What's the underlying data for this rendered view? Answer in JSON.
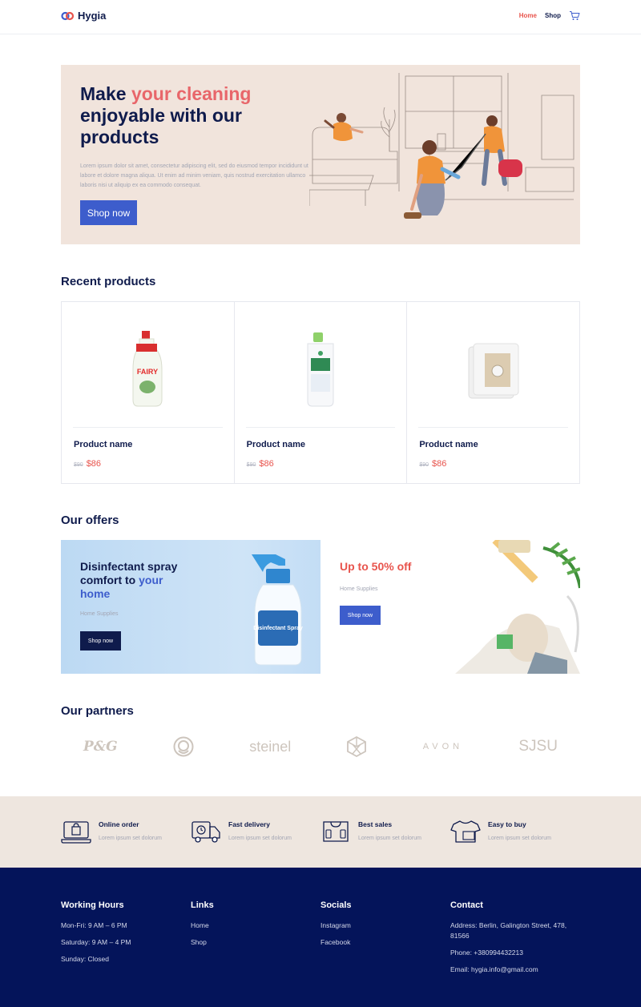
{
  "header": {
    "logo_text": "Hygia",
    "nav": [
      {
        "label": "Home",
        "active": true
      },
      {
        "label": "Shop",
        "active": false
      }
    ],
    "cart_icon": "cart-icon"
  },
  "hero": {
    "title_part1": "Make ",
    "title_accent": "your cleaning",
    "title_part2": " enjoyable with our products",
    "description": "Lorem ipsum dolor sit amet, consectetur adipiscing elit, sed do eiusmod tempor incididunt ut labore et dolore magna aliqua. Ut enim ad minim veniam, quis nostrud exercitation ullamco laboris nisi ut aliquip ex ea commodo consequat.",
    "button_label": "Shop now"
  },
  "recent": {
    "title": "Recent products",
    "products": [
      {
        "name": "Product name",
        "old_price": "$90",
        "price": "$86",
        "image": "dish-soap-bottle"
      },
      {
        "name": "Product name",
        "old_price": "$90",
        "price": "$86",
        "image": "detergent-bottle"
      },
      {
        "name": "Product name",
        "old_price": "$90",
        "price": "$86",
        "image": "vacuum-bags"
      }
    ]
  },
  "offers": {
    "title": "Our offers",
    "left": {
      "title_part1": "Disinfectant spray comfort to ",
      "title_blue": "your home",
      "category": "Home Supplies",
      "button_label": "Shop now",
      "label_on_bottle": "Disinfectant Spray"
    },
    "right": {
      "title": "Up to 50% off",
      "category": "Home Supplies",
      "button_label": "Shop now"
    }
  },
  "partners": {
    "title": "Our partners",
    "items": [
      "P&G",
      "",
      "steinel",
      "",
      "AVON",
      "SJSU"
    ]
  },
  "features": [
    {
      "title": "Online order",
      "sub": "Lorem ipsum set dolorum",
      "icon": "laptop-bag-icon"
    },
    {
      "title": "Fast delivery",
      "sub": "Lorem ipsum set dolorum",
      "icon": "delivery-truck-icon"
    },
    {
      "title": "Best sales",
      "sub": "Lorem ipsum set dolorum",
      "icon": "sale-tag-icon"
    },
    {
      "title": "Easy to buy",
      "sub": "Lorem ipsum set dolorum",
      "icon": "tshirt-icon"
    }
  ],
  "footer": {
    "hours": {
      "title": "Working Hours",
      "items": [
        "Mon-Fri: 9 AM – 6 PM",
        "Saturday: 9 AM – 4 PM",
        "Sunday: Closed"
      ]
    },
    "links": {
      "title": "Links",
      "items": [
        "Home",
        "Shop"
      ]
    },
    "socials": {
      "title": "Socials",
      "items": [
        "Instagram",
        "Facebook"
      ]
    },
    "contact": {
      "title": "Contact",
      "items": [
        "Address: Berlin, Galington Street, 478, 81566",
        "Phone: +380994432213",
        "Email: hygia.info@gmail.com"
      ]
    }
  },
  "colors": {
    "accent_red": "#e8544d",
    "navy": "#0f1b4c",
    "blue": "#3d5dcc",
    "footer_bg": "#04145a",
    "hero_bg": "#f1e4dc"
  }
}
